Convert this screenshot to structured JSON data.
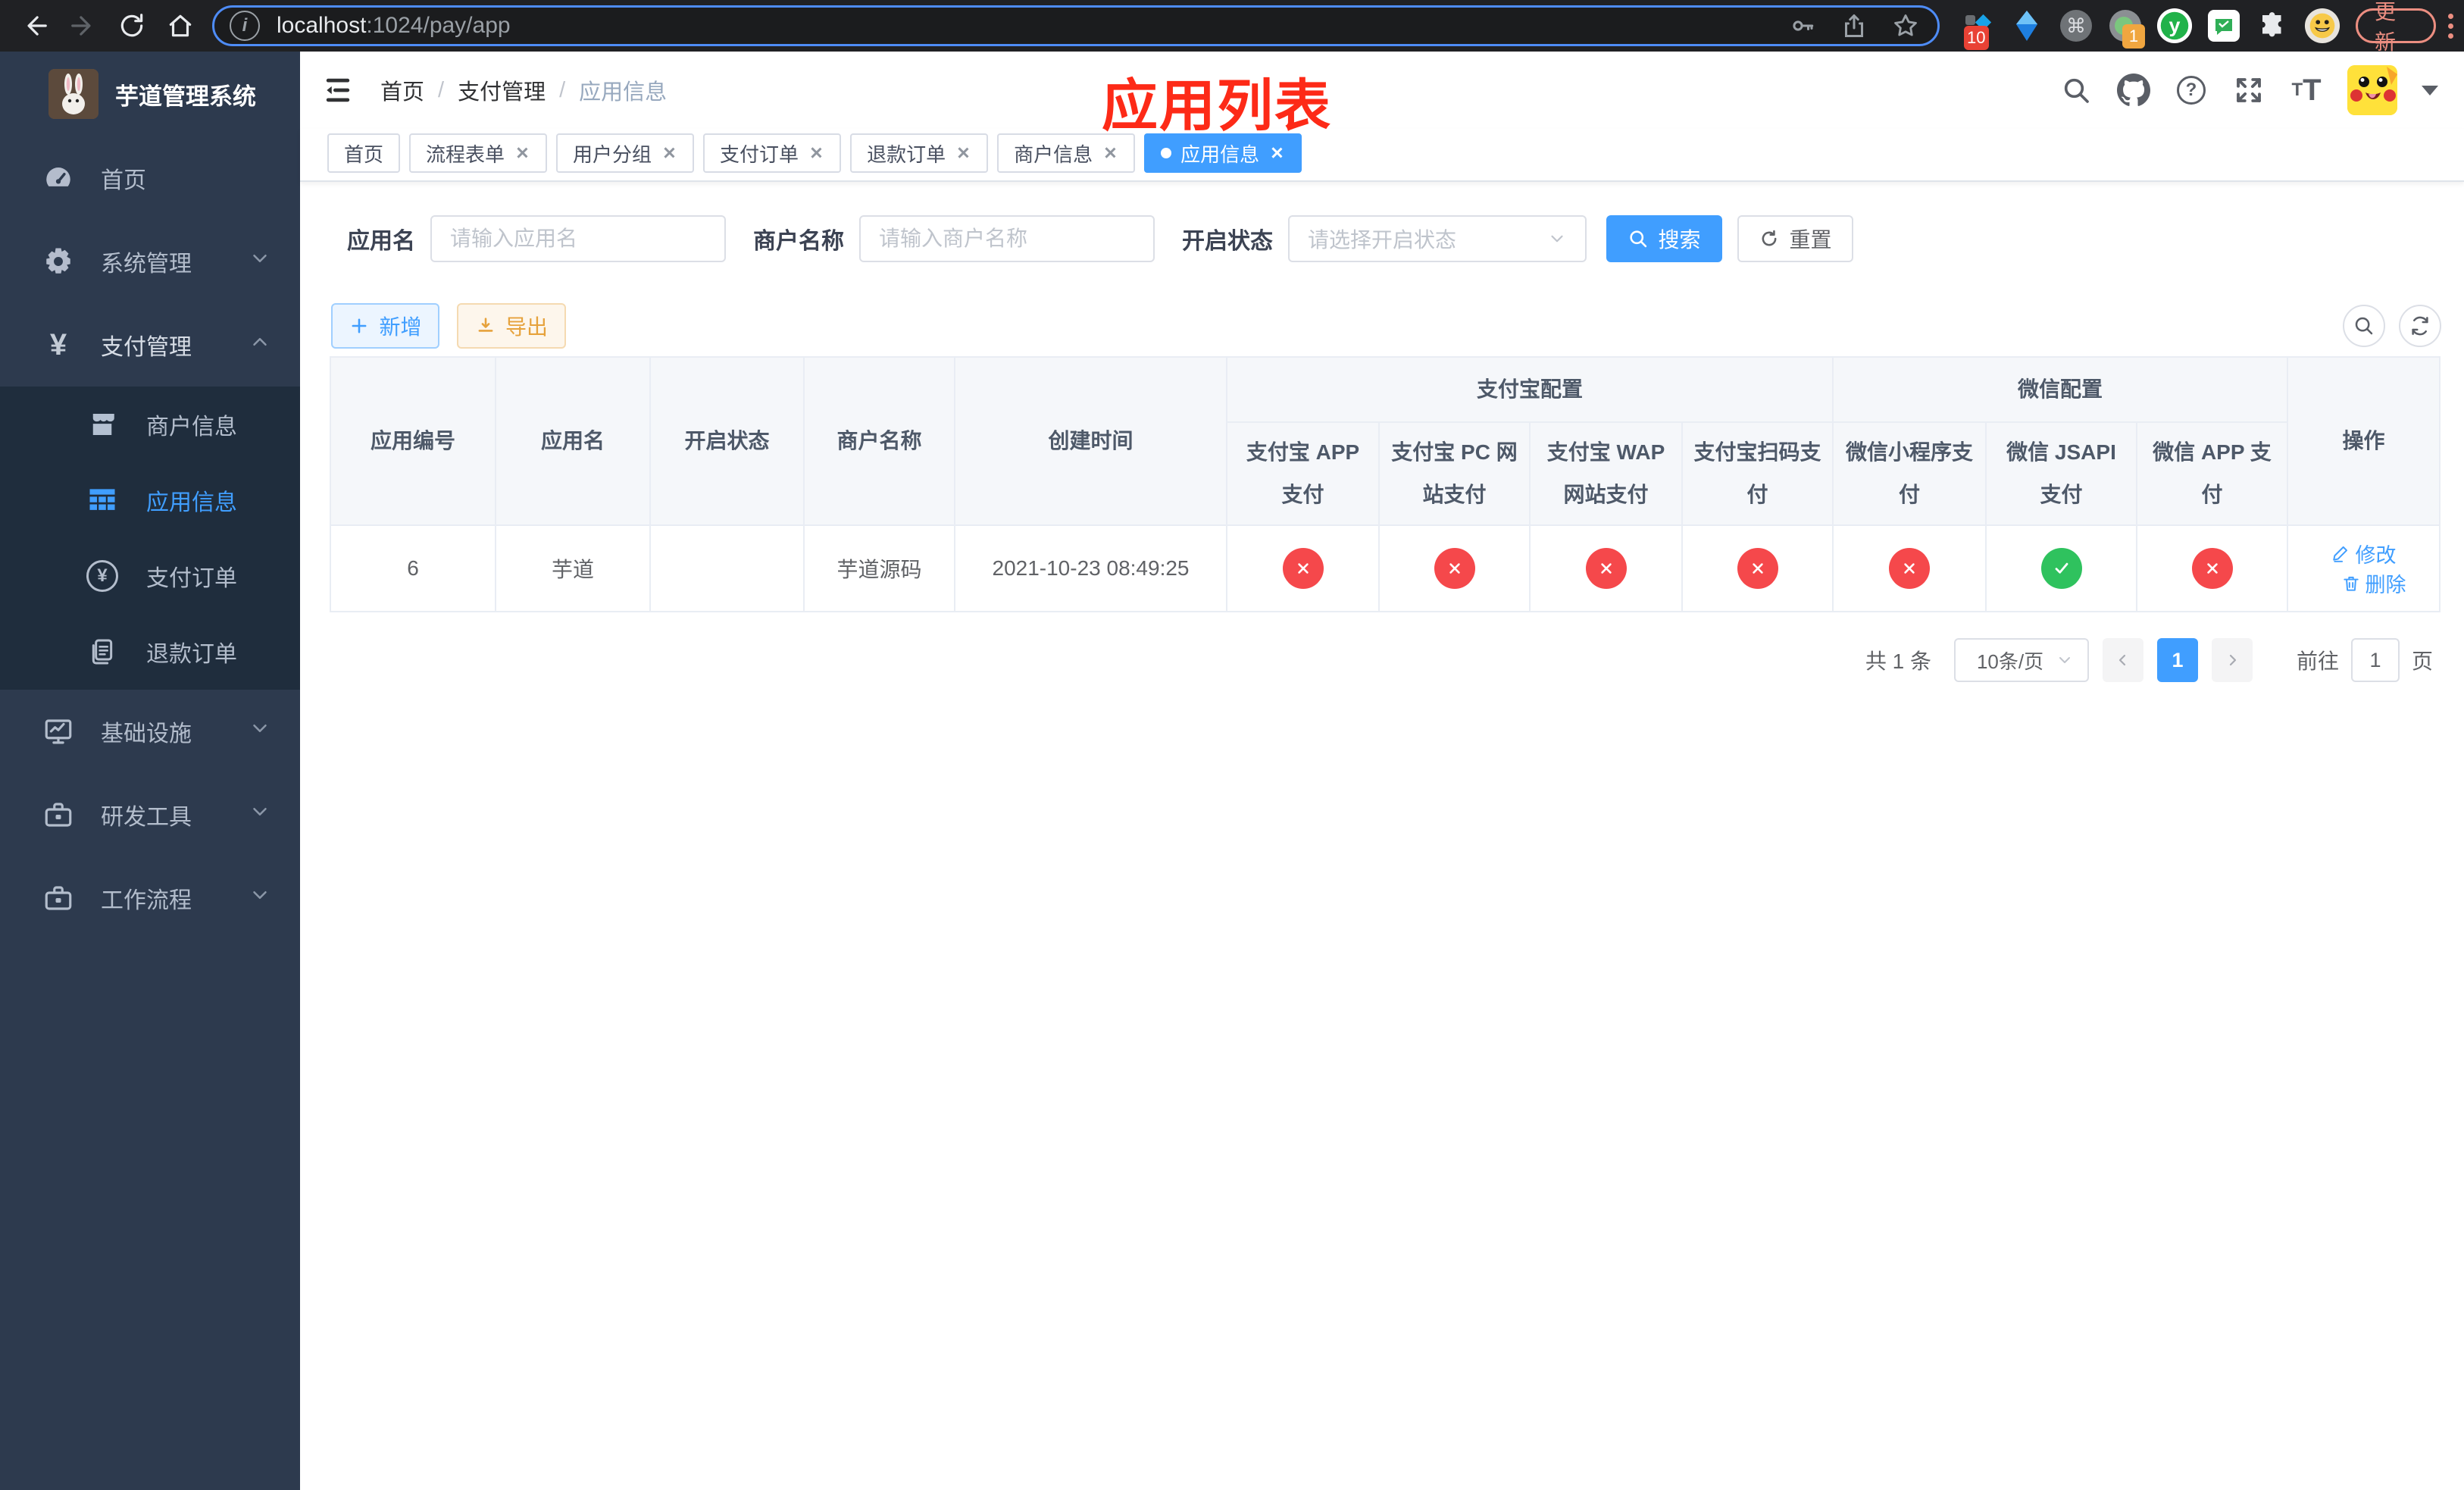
{
  "browser": {
    "url_host": "localhost",
    "url_rest": ":1024/pay/app",
    "update_button": "更新",
    "ext_badge_pin": "10",
    "ext_badge_session": "1"
  },
  "icons": {
    "yen": "¥",
    "question": "?",
    "info": "i",
    "cmd": "⌘",
    "ext_y": "y",
    "t_small": "T",
    "t_big": "T"
  },
  "sidebar": {
    "title": "芋道管理系统",
    "menu": {
      "home": "首页",
      "system": "系统管理",
      "payment": "支付管理",
      "merchant_info": "商户信息",
      "app_info": "应用信息",
      "pay_order": "支付订单",
      "refund_order": "退款订单",
      "infra": "基础设施",
      "dev_tools": "研发工具",
      "workflow": "工作流程"
    }
  },
  "navbar": {
    "breadcrumb": {
      "b0": "首页",
      "b1": "支付管理",
      "b2": "应用信息"
    }
  },
  "annotation": "应用列表",
  "tabs": {
    "t0": "首页",
    "t1": "流程表单",
    "t2": "用户分组",
    "t3": "支付订单",
    "t4": "退款订单",
    "t5": "商户信息",
    "t6": "应用信息"
  },
  "filters": {
    "app_name_label": "应用名",
    "app_name_placeholder": "请输入应用名",
    "merchant_label": "商户名称",
    "merchant_placeholder": "请输入商户名称",
    "status_label": "开启状态",
    "status_placeholder": "请选择开启状态",
    "search_button": "搜索",
    "reset_button": "重置"
  },
  "toolbar": {
    "add_button": "新增",
    "export_button": "导出"
  },
  "table": {
    "groups": {
      "alipay": "支付宝配置",
      "wechat": "微信配置"
    },
    "columns": {
      "app_id": "应用编号",
      "app_name": "应用名",
      "status": "开启状态",
      "merchant": "商户名称",
      "created": "创建时间",
      "alipay_app": "支付宝 APP 支付",
      "alipay_pc": "支付宝 PC 网站支付",
      "alipay_wap": "支付宝 WAP 网站支付",
      "alipay_qr": "支付宝扫码支付",
      "wx_lite": "微信小程序支付",
      "wx_jsapi": "微信 JSAPI 支付",
      "wx_app": "微信 APP 支付",
      "actions": "操作"
    },
    "row": {
      "app_id": "6",
      "app_name": "芋道",
      "enabled": true,
      "merchant": "芋道源码",
      "created": "2021-10-23 08:49:25",
      "channels": {
        "alipay_app": false,
        "alipay_pc": false,
        "alipay_wap": false,
        "alipay_qr": false,
        "wx_lite": false,
        "wx_jsapi": true,
        "wx_app": false
      }
    },
    "row_actions": {
      "edit": "修改",
      "delete": "删除"
    }
  },
  "pagination": {
    "total": "共 1 条",
    "page_size": "10条/页",
    "page": "1",
    "goto_label": "前往",
    "goto_value": "1",
    "page_unit": "页"
  }
}
